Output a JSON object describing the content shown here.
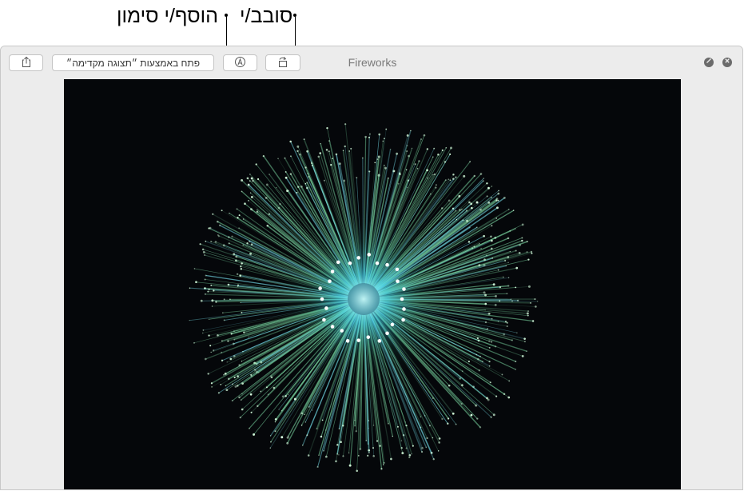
{
  "callouts": {
    "rotate": "סובב/י",
    "markup": "הוסף/י סימון"
  },
  "window": {
    "title": "Fireworks"
  },
  "toolbar": {
    "open_with_preview": "פתח באמצעות ״תצוגה מקדימה״"
  },
  "icons": {
    "share": "share-icon",
    "markup": "markup-icon",
    "rotate": "rotate-icon",
    "minimize": "minimize-icon",
    "close": "close-icon"
  },
  "colors": {
    "window_bg": "#ececec",
    "photo_bg": "#05070a",
    "firework_green": "#7fe0a8",
    "firework_cyan": "#7ff2ff",
    "control_gray": "#6b6b6b"
  }
}
